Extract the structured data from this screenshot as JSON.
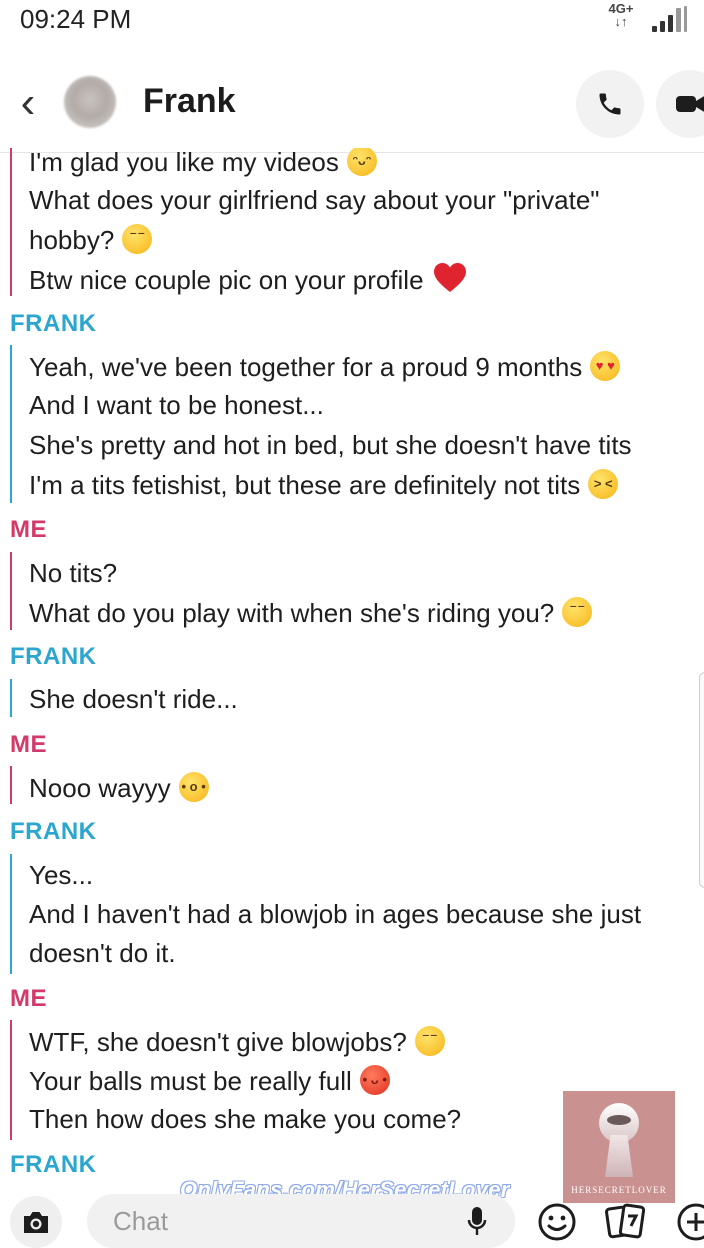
{
  "status_bar": {
    "time": "09:24 PM",
    "network": "4G+",
    "net_arrows": "↓↑"
  },
  "header": {
    "back_icon": "‹",
    "contact_name": "Frank"
  },
  "messages": [
    {
      "sender": "",
      "lines": [
        "I'm glad you like my videos",
        "What does your girlfriend say about your \"private\"",
        "hobby?",
        "Btw nice couple pic on your profile"
      ]
    },
    {
      "sender": "FRANK",
      "lines": [
        "Yeah, we've been together for a proud 9 months",
        "And I want to be honest...",
        "She's pretty and hot in bed, but she doesn't have tits",
        "I'm a tits fetishist, but these are definitely not tits"
      ]
    },
    {
      "sender": "ME",
      "lines": [
        "No tits?",
        "What do you play with when she's riding you?"
      ]
    },
    {
      "sender": "FRANK",
      "lines": [
        "She doesn't ride..."
      ]
    },
    {
      "sender": "ME",
      "lines": [
        "Nooo wayyy"
      ]
    },
    {
      "sender": "FRANK",
      "lines": [
        "Yes...",
        "And I haven't had a blowjob in ages because she just",
        "doesn't do it."
      ]
    },
    {
      "sender": "ME",
      "lines": [
        "WTF, she doesn't give blowjobs?",
        "Your balls must be really full",
        "Then how does she make you come?"
      ]
    },
    {
      "sender": "FRANK",
      "lines": []
    }
  ],
  "composer": {
    "placeholder": "Chat"
  },
  "watermark": {
    "link": "OnlyFans.com/HerSecretLover",
    "logo_text": "HERSECRETLOVER"
  },
  "colors": {
    "frank": "#2aa6cf",
    "me": "#d23a6a"
  }
}
